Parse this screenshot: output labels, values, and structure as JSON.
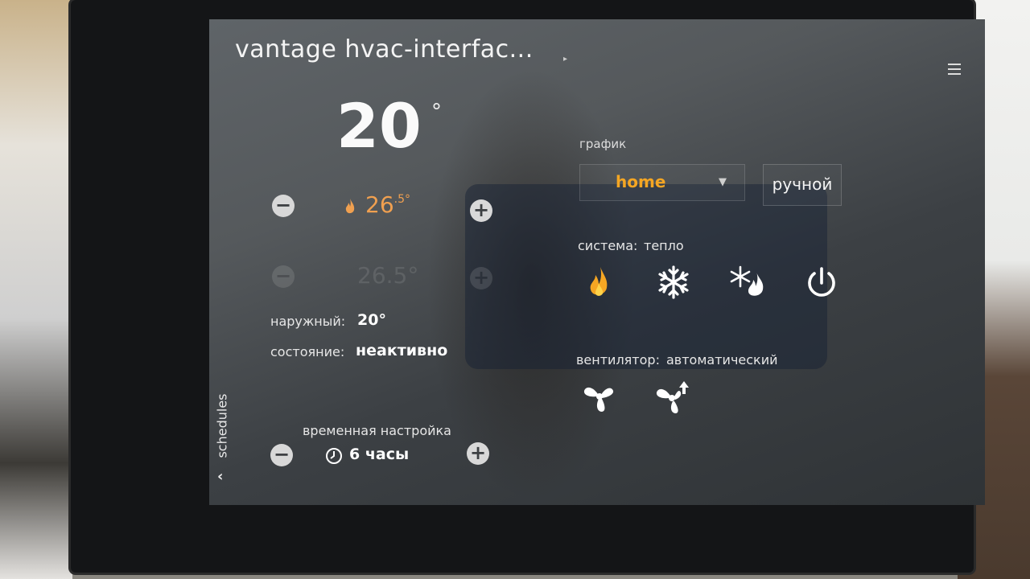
{
  "header": {
    "title": "vantage hvac-interfac..."
  },
  "current": {
    "temperature": "20",
    "degree": "°"
  },
  "setpoint": {
    "value": "26",
    "decimal": ".5°",
    "ghost_value": "26.5°"
  },
  "status": {
    "outdoor_label": "наружный:",
    "outdoor_value": "20°",
    "state_label": "состояние:",
    "state_value": "неактивно"
  },
  "schedule": {
    "label": "график",
    "selected": "home",
    "manual_label": "ручной"
  },
  "system": {
    "label": "система:",
    "mode": "тепло",
    "icons": [
      "flame-icon",
      "snowflake-icon",
      "snowflake-flame-icon",
      "power-icon"
    ]
  },
  "fan": {
    "label": "вентилятор:",
    "mode": "автоматический",
    "icons": [
      "fan-icon",
      "fan-auto-icon"
    ]
  },
  "hold": {
    "label": "временная настройка",
    "value": "6 часы"
  },
  "sidebar": {
    "schedules_label": "schedules"
  },
  "colors": {
    "accent": "#f5a623",
    "setpoint": "#f0a050",
    "text": "#f2f2f2"
  }
}
